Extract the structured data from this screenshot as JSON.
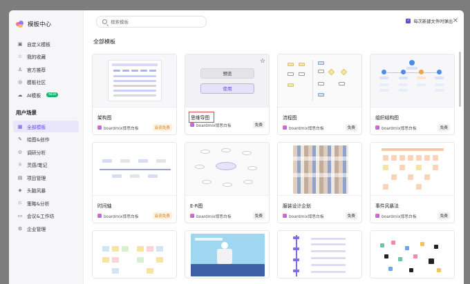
{
  "sidebar": {
    "brand_title": "模板中心",
    "items": [
      {
        "label": "自定义模板",
        "icon": "template-icon"
      },
      {
        "label": "我的收藏",
        "icon": "star-icon"
      },
      {
        "label": "官方推荐",
        "icon": "thumbs-up-icon"
      },
      {
        "label": "模板社区",
        "icon": "community-icon"
      },
      {
        "label": "AI模板",
        "icon": "cloud-icon",
        "badge": "NEW"
      }
    ],
    "section_label": "用户场景",
    "scenes": [
      {
        "label": "全部模板",
        "icon": "grid-icon",
        "active": true
      },
      {
        "label": "绘图&创作",
        "icon": "pen-icon"
      },
      {
        "label": "调研分析",
        "icon": "analysis-icon"
      },
      {
        "label": "灵感/笔记",
        "icon": "bulb-icon"
      },
      {
        "label": "项目管理",
        "icon": "project-icon"
      },
      {
        "label": "头脑风暴",
        "icon": "brain-icon"
      },
      {
        "label": "策略&分析",
        "icon": "strategy-icon"
      },
      {
        "label": "会议&工作坊",
        "icon": "meeting-icon"
      },
      {
        "label": "企业管理",
        "icon": "enterprise-icon"
      }
    ]
  },
  "search": {
    "placeholder": "搜索模板"
  },
  "option": {
    "label": "每次新建文件时弹出",
    "checked": true
  },
  "heading": "全部模板",
  "hover": {
    "preview": "预览",
    "use": "使用"
  },
  "cards": [
    {
      "name": "架构图",
      "author": "boardmix博思白板",
      "tag": "会员免费",
      "tag_type": "vip"
    },
    {
      "name": "思维导图",
      "author": "boardmix博思白板",
      "tag": "免费",
      "tag_type": "free"
    },
    {
      "name": "流程图",
      "author": "boardmix博思白板",
      "tag": "免费",
      "tag_type": "free"
    },
    {
      "name": "组织结构图",
      "author": "boardmix博思白板",
      "tag": "免费",
      "tag_type": "free"
    },
    {
      "name": "时间轴",
      "author": "boardmix博思白板",
      "tag": "会员免费",
      "tag_type": "vip"
    },
    {
      "name": "E-R图",
      "author": "boardmix博思白板",
      "tag": "免费",
      "tag_type": "free"
    },
    {
      "name": "服装设计企划",
      "author": "boardmix博思白板",
      "tag": "免费",
      "tag_type": "free"
    },
    {
      "name": "事件风暴法",
      "author": "boardmix博思白板",
      "tag": "免费",
      "tag_type": "free"
    }
  ],
  "colors": {
    "accent": "#5b4de0",
    "vip_text": "#d9822b",
    "highlight": "#e0454a"
  }
}
